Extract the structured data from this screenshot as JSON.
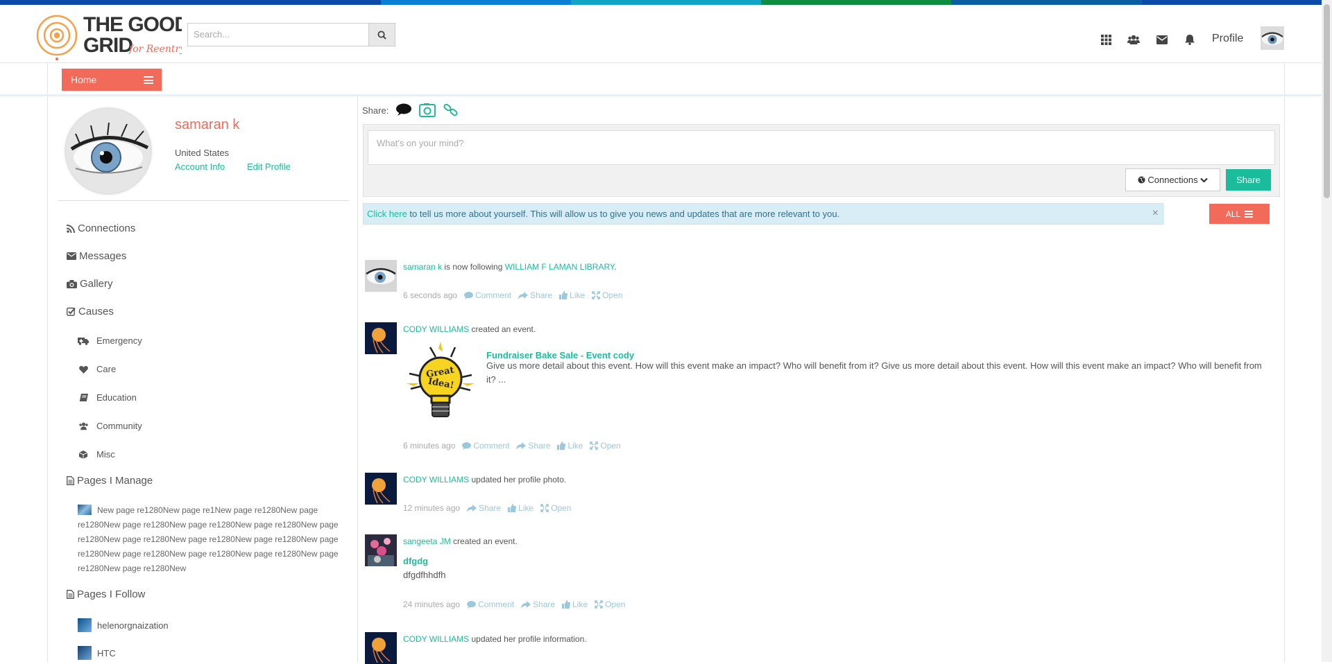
{
  "colors": {
    "accent": "#f26a5a",
    "link": "#1abc9c",
    "topbar": [
      "#0b4aa8",
      "#0a64c0",
      "#13a3c4",
      "#0e8d42",
      "#0b5ea0"
    ]
  },
  "logo": {
    "line1": "THE GOOD",
    "line2": "GRID",
    "tag": "for Reentry"
  },
  "search": {
    "placeholder": "Search...",
    "icon": "search-icon"
  },
  "header": {
    "icons": [
      "apps-grid-icon",
      "users-icon",
      "envelope-icon",
      "bell-icon"
    ],
    "profile_label": "Profile"
  },
  "subnav": {
    "home_label": "Home"
  },
  "profile": {
    "name": "samaran k",
    "country": "United States",
    "account_info": "Account Info",
    "edit_profile": "Edit Profile"
  },
  "sidebar": {
    "nav": [
      {
        "label": "Connections",
        "icon": "rss-icon"
      },
      {
        "label": "Messages",
        "icon": "envelope-icon"
      },
      {
        "label": "Gallery",
        "icon": "camera-icon"
      },
      {
        "label": "Causes",
        "icon": "check-square-icon"
      }
    ],
    "causes": [
      {
        "label": "Emergency",
        "icon": "ambulance-icon"
      },
      {
        "label": "Care",
        "icon": "heart-icon"
      },
      {
        "label": "Education",
        "icon": "book-icon"
      },
      {
        "label": "Community",
        "icon": "users-icon"
      },
      {
        "label": "Misc",
        "icon": "cube-icon"
      }
    ],
    "pages_manage_label": "Pages I Manage",
    "pages_manage_text": "New page re1280New page re1New page re1280New page re1280New page re1280New page re1280New page re1280New page re1280New page re1280New page re1280New page re1280New page re1280New page re1280New page re1280New page re1280New page re1280New page re1280New",
    "pages_follow_label": "Pages I Follow",
    "pages_follow": [
      "helenorgnaization",
      "HTC"
    ]
  },
  "composer": {
    "share_label": "Share:",
    "placeholder": "What's on your mind?",
    "connections_label": "Connections",
    "share_button": "Share"
  },
  "alert": {
    "link": "Click here",
    "text": " to tell us more about yourself. This will allow us to give you news and updates that are more relevant to you.",
    "close": "×"
  },
  "filter": {
    "all_label": "ALL"
  },
  "actions": {
    "comment": "Comment",
    "share": "Share",
    "like": "Like",
    "open": "Open"
  },
  "feed": [
    {
      "actor": "samaran k",
      "verb": " is now following ",
      "target": "WILLIAM F LAMAN LIBRARY",
      "end": ".",
      "time": "6 seconds ago"
    },
    {
      "actor": "CODY WILLIAMS",
      "verb": " created an event.",
      "event_title": "Fundraiser Bake Sale - Event cody",
      "event_desc": "Give us more detail about this event. How will this event make an impact? Who will benefit from it? Give us more detail about this event. How will this event make an impact? Who will benefit from it? ...",
      "image_text": "Great Idea!",
      "time": "6 minutes ago"
    },
    {
      "actor": "CODY WILLIAMS",
      "verb": " updated her profile photo.",
      "time": "12 minutes ago"
    },
    {
      "actor": "sangeeta JM",
      "verb": " created an event.",
      "event_title": "dfgdg",
      "event_desc": "dfgdfhhdfh",
      "time": "24 minutes ago"
    },
    {
      "actor": "CODY WILLIAMS",
      "verb": " updated her profile information."
    }
  ]
}
